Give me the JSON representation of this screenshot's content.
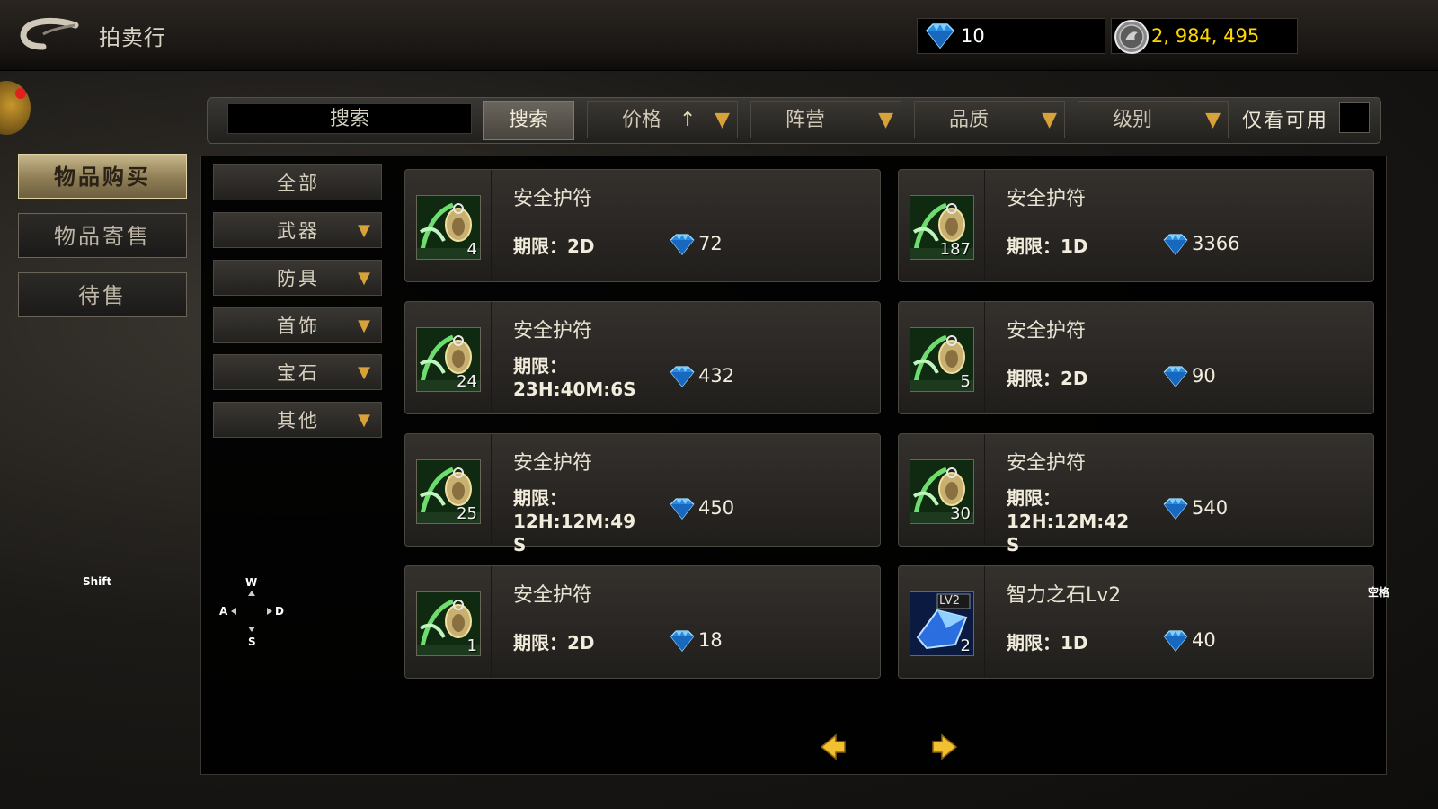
{
  "header": {
    "title": "拍卖行",
    "diamonds": "10",
    "silver": "2, 984, 495"
  },
  "left_nav": [
    {
      "label": "物品购买",
      "active": true
    },
    {
      "label": "物品寄售",
      "active": false
    },
    {
      "label": "待售",
      "active": false
    }
  ],
  "search": {
    "placeholder": "搜索",
    "button": "搜索",
    "filters": [
      {
        "label": "价格",
        "arrow": "↑"
      },
      {
        "label": "阵营",
        "arrow": ""
      },
      {
        "label": "品质",
        "arrow": ""
      },
      {
        "label": "级别",
        "arrow": ""
      }
    ],
    "only_available_label": "仅看可用"
  },
  "categories": [
    {
      "label": "全部",
      "has_dropdown": false
    },
    {
      "label": "武器",
      "has_dropdown": true
    },
    {
      "label": "防具",
      "has_dropdown": true
    },
    {
      "label": "首饰",
      "has_dropdown": true
    },
    {
      "label": "宝石",
      "has_dropdown": true
    },
    {
      "label": "其他",
      "has_dropdown": true
    }
  ],
  "items": [
    {
      "name": "安全护符",
      "duration": "期限：2D",
      "price": "72",
      "qty": "4",
      "icon": "amulet-icon"
    },
    {
      "name": "安全护符",
      "duration": "期限：1D",
      "price": "3366",
      "qty": "187",
      "icon": "amulet-icon"
    },
    {
      "name": "安全护符",
      "duration": "期限：\n23H:40M:6S",
      "price": "432",
      "qty": "24",
      "icon": "amulet-icon"
    },
    {
      "name": "安全护符",
      "duration": "期限：2D",
      "price": "90",
      "qty": "5",
      "icon": "amulet-icon"
    },
    {
      "name": "安全护符",
      "duration": "期限：\n12H:12M:49\nS",
      "price": "450",
      "qty": "25",
      "icon": "amulet-icon"
    },
    {
      "name": "安全护符",
      "duration": "期限：\n12H:12M:42\nS",
      "price": "540",
      "qty": "30",
      "icon": "amulet-icon"
    },
    {
      "name": "安全护符",
      "duration": "期限：2D",
      "price": "18",
      "qty": "1",
      "icon": "amulet-icon"
    },
    {
      "name": "智力之石Lv2",
      "duration": "期限：1D",
      "price": "40",
      "qty": "2",
      "icon": "intelligence-stone-icon",
      "badge": "LV2"
    }
  ],
  "key_hints": {
    "shift": "Shift",
    "w": "W",
    "a": "A",
    "s": "S",
    "d": "D",
    "space": "空格"
  },
  "colors": {
    "accent_gold": "#d8a23a",
    "silver_text": "#ffd700",
    "diamond": "#3aa8f0"
  }
}
